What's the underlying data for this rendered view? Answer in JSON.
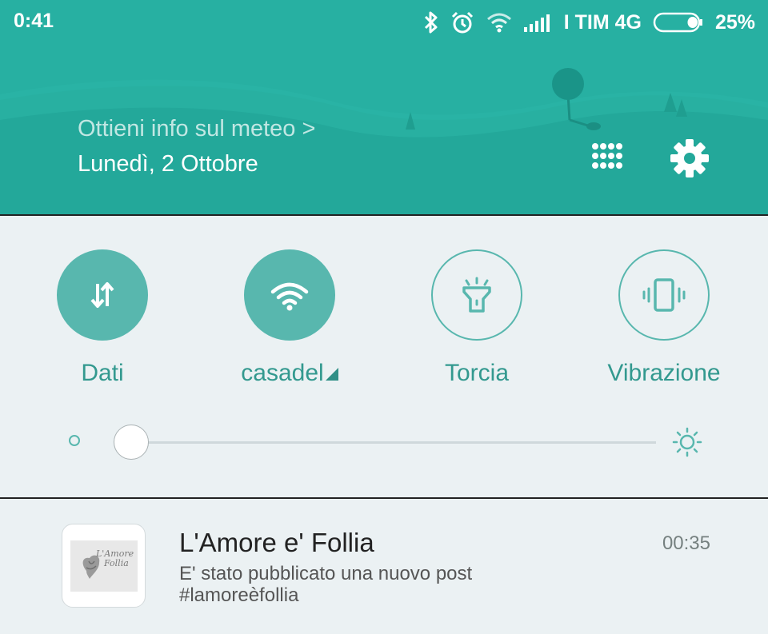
{
  "status_bar": {
    "time": "0:41",
    "carrier": "I TIM 4G",
    "battery_percent": "25%",
    "battery_level": 0.25,
    "icons": [
      "bluetooth-icon",
      "alarm-clock-icon",
      "wifi-signal-icon",
      "cellular-signal-icon",
      "battery-icon"
    ]
  },
  "header": {
    "weather_link": "Ottieni info sul meteo >",
    "date": "Lunedì, 2 Ottobre",
    "icons": [
      "apps-grid-icon",
      "gear-icon"
    ]
  },
  "toggles": [
    {
      "label": "Dati",
      "state": "on",
      "icon": "data-arrows-icon"
    },
    {
      "label": "casadel",
      "state": "on",
      "icon": "wifi-icon"
    },
    {
      "label": "Torcia",
      "state": "off",
      "icon": "flashlight-icon"
    },
    {
      "label": "Vibrazione",
      "state": "off",
      "icon": "vibrate-icon"
    }
  ],
  "brightness": {
    "level": 0.03,
    "icons": [
      "brightness-low-icon",
      "brightness-high-icon"
    ]
  },
  "notification": {
    "title": "L'Amore e' Follia",
    "time": "00:35",
    "line1": "E' stato pubblicato una nuovo post",
    "line2": "#lamoreèfollia",
    "icon_lettering": "L'Amore è Follia"
  },
  "colors": {
    "accent": "#23a89a",
    "toggle_fill": "#58b7ae",
    "label": "#33998f",
    "panel_bg": "#ebf1f3"
  }
}
